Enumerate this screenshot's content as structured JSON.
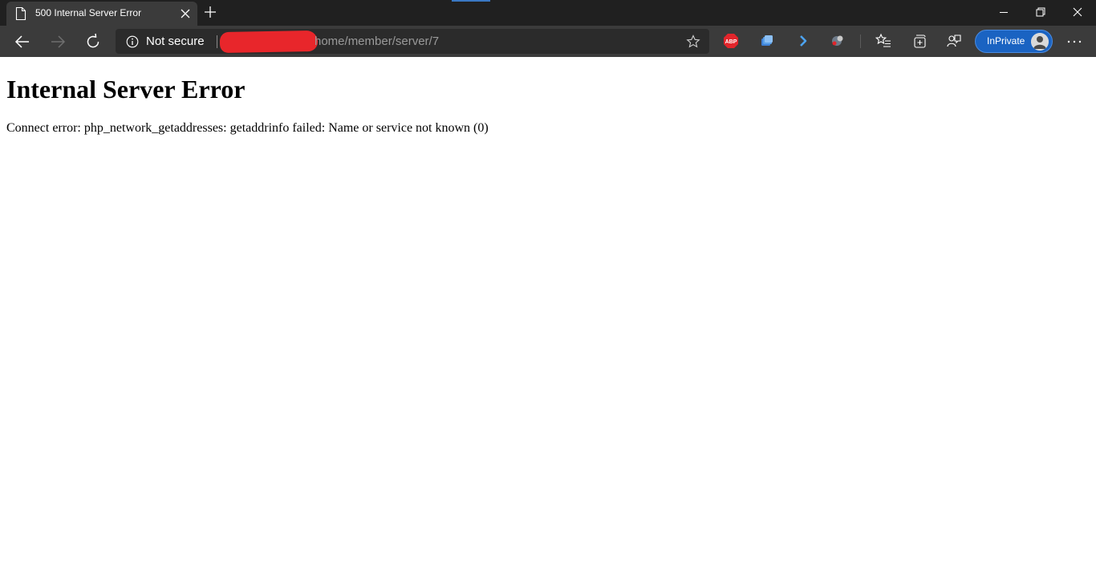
{
  "browser": {
    "tab": {
      "title": "500 Internal Server Error"
    },
    "address_bar": {
      "security_label": "Not secure",
      "url_path": "home/member/server/7"
    },
    "extensions": [
      {
        "name": "adblock-plus",
        "label": "ABP",
        "color": "#e2252b"
      },
      {
        "name": "extension-2",
        "color": "#5aa0e8"
      },
      {
        "name": "extension-3",
        "color": "#4da3f0"
      },
      {
        "name": "extension-4",
        "color": "#9a9a9a"
      }
    ],
    "profile": {
      "label": "InPrivate",
      "color": "#1a63c2"
    }
  },
  "page": {
    "heading": "Internal Server Error",
    "message": "Connect error: php_network_getaddresses: getaddrinfo failed: Name or service not known (0)"
  }
}
